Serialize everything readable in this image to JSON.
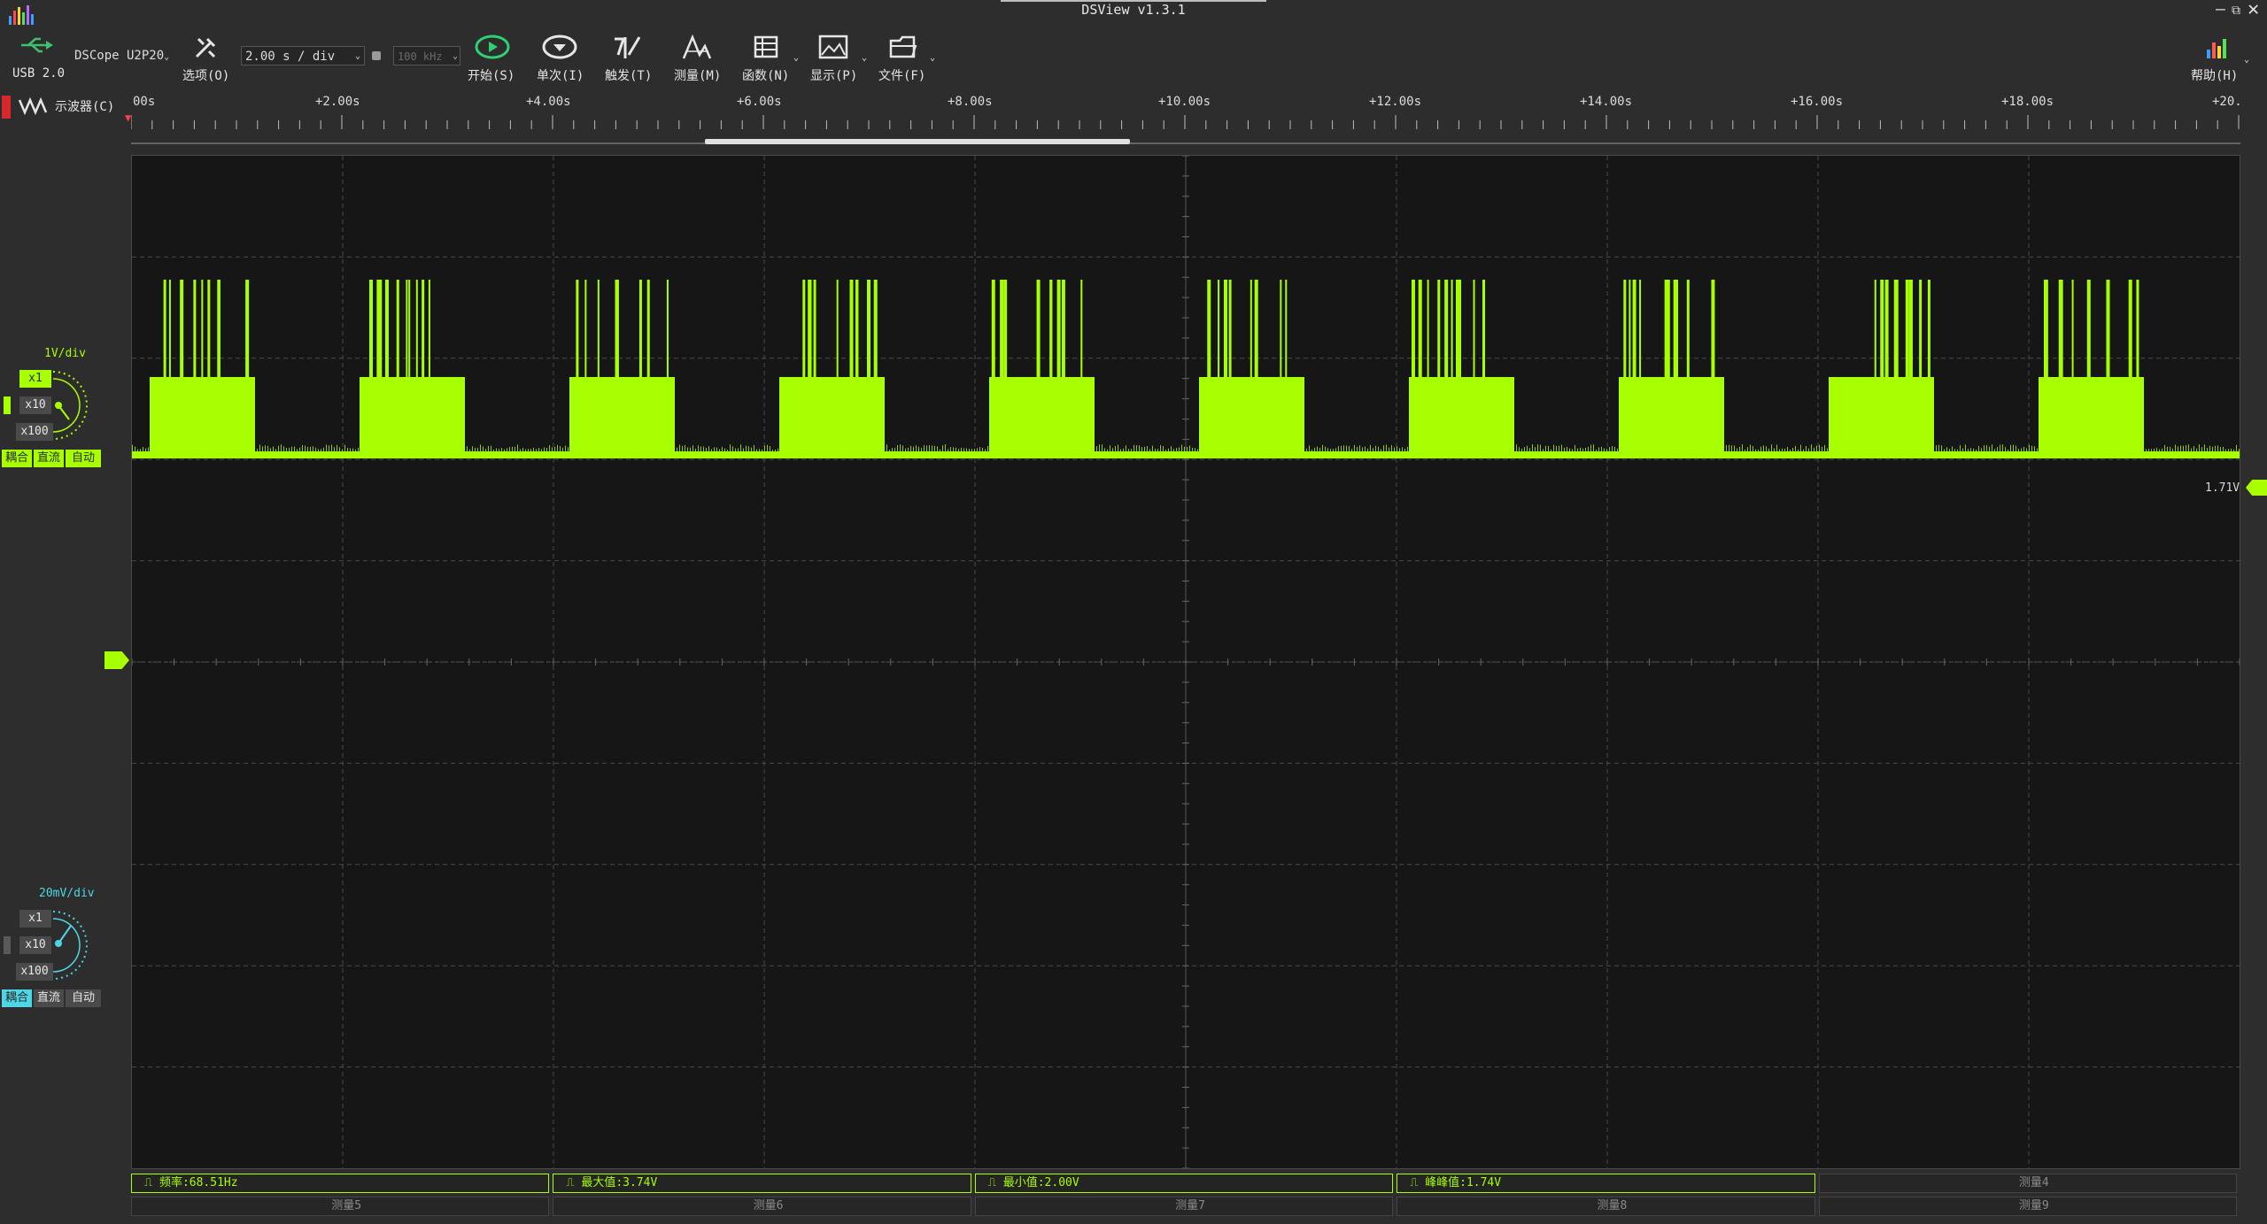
{
  "window": {
    "title": "DSView v1.3.1"
  },
  "device": {
    "usb_label": "USB 2.0",
    "model": "DSCope U2P20",
    "timebase": "2.00 s / div",
    "sample_rate": "100 kHz"
  },
  "toolbar": {
    "options": "选项(O)",
    "start": "开始(S)",
    "single": "单次(I)",
    "trigger": "触发(T)",
    "measure": "测量(M)",
    "function": "函数(N)",
    "display": "显示(P)",
    "file": "文件(F)",
    "help": "帮助(H)"
  },
  "mode": {
    "label": "示波器(C)"
  },
  "ruler": {
    "labels": [
      "00s",
      "+2.00s",
      "+4.00s",
      "+6.00s",
      "+8.00s",
      "+10.00s",
      "+12.00s",
      "+14.00s",
      "+16.00s",
      "+18.00s",
      "+20."
    ]
  },
  "channel1": {
    "vdiv": "1V/div",
    "probe": [
      "x1",
      "x10",
      "x100"
    ],
    "coupling": [
      "耦合",
      "直流",
      "自动"
    ],
    "level_label": "1.71V",
    "color": "#a8ff00"
  },
  "channel2": {
    "vdiv": "20mV/div",
    "probe": [
      "x1",
      "x10",
      "x100"
    ],
    "coupling": [
      "耦合",
      "直流",
      "自动"
    ],
    "color": "#4fd6e6"
  },
  "measurements": [
    {
      "text": "频率:68.51Hz",
      "active": true
    },
    {
      "text": "最大值:3.74V",
      "active": true
    },
    {
      "text": "最小值:2.00V",
      "active": true
    },
    {
      "text": "峰峰值:1.74V",
      "active": true
    },
    {
      "text": "测量4",
      "active": false
    },
    {
      "text": "测量5",
      "active": false
    },
    {
      "text": "测量6",
      "active": false
    },
    {
      "text": "测量7",
      "active": false
    },
    {
      "text": "测量8",
      "active": false
    },
    {
      "text": "测量9",
      "active": false
    }
  ]
}
